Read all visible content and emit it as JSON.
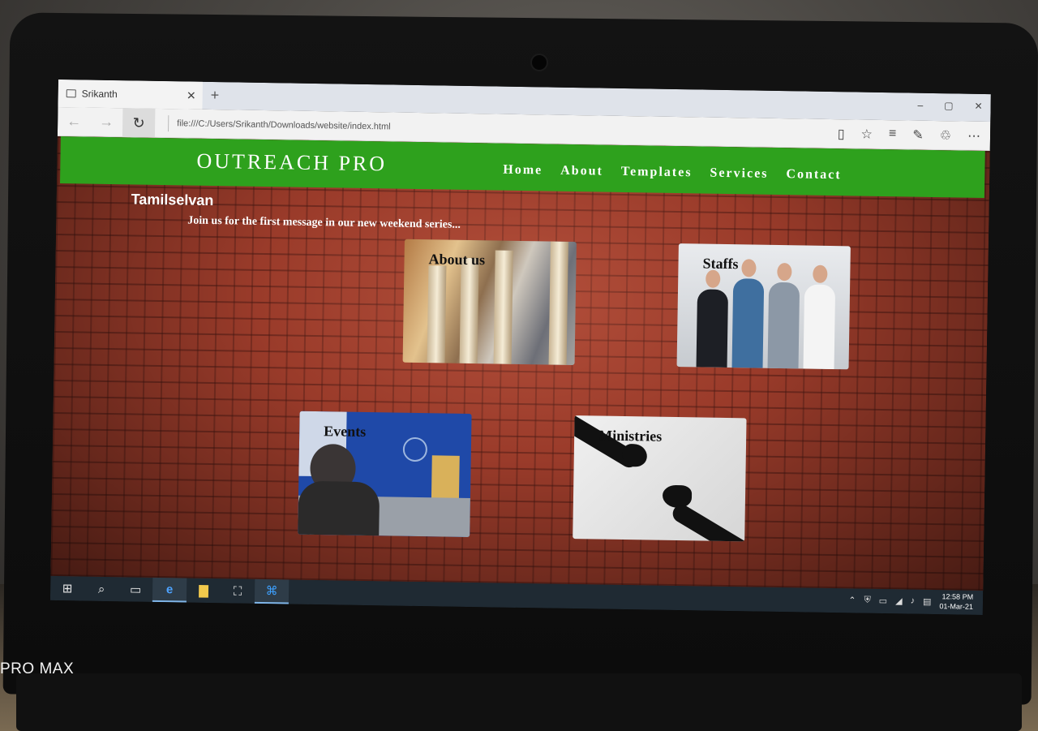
{
  "photo": {
    "watermark": "PRO MAX"
  },
  "browser": {
    "tab_title": "Srikanth",
    "new_tab": "+",
    "url": "file:///C:/Users/Srikanth/Downloads/website/index.html",
    "window_controls": [
      "–",
      "▢",
      "✕"
    ]
  },
  "site": {
    "brand": "OUTREACH PRO",
    "nav": [
      "Home",
      "About",
      "Templates",
      "Services",
      "Contact"
    ],
    "username": "Tamilselvan",
    "tagline": "Join us for the first message in our new weekend series...",
    "cards": [
      {
        "label": "About us",
        "image": "building-columns"
      },
      {
        "label": "Staffs",
        "image": "team-photo"
      },
      {
        "label": "Events",
        "image": "press-conference"
      },
      {
        "label": "Ministries",
        "image": "reaching-hands"
      }
    ],
    "colors": {
      "header": "#2ea11d",
      "brick": "#9a3b2a"
    }
  },
  "taskbar": {
    "icons": [
      "windows-start-icon",
      "search-icon",
      "task-view-icon",
      "edge-icon",
      "file-explorer-icon",
      "store-icon",
      "vscode-icon"
    ],
    "time": "12:58 PM",
    "date": "01-Mar-21"
  }
}
